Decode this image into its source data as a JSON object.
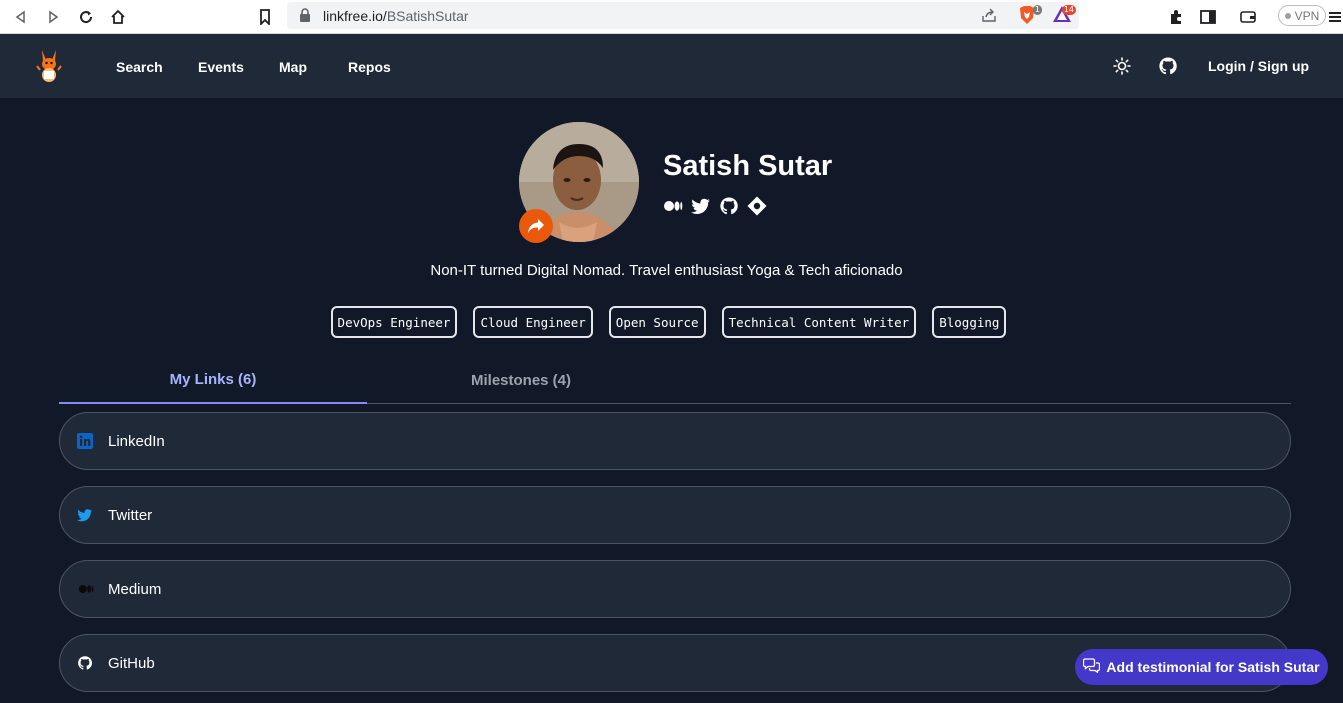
{
  "browser": {
    "url_domain": "linkfree.io/",
    "url_path": "BSatishSutar",
    "brave_badge": "1",
    "ext_badge": "14",
    "vpn_label": "VPN"
  },
  "nav": {
    "links": [
      "Search",
      "Events",
      "Map",
      "Repos"
    ],
    "login_label": "Login / Sign up"
  },
  "profile": {
    "name": "Satish Sutar",
    "bio": "Non-IT turned Digital Nomad. Travel enthusiast Yoga & Tech aficionado",
    "social_icons": [
      "medium-icon",
      "twitter-icon",
      "github-icon",
      "website-icon"
    ],
    "tags": [
      "DevOps Engineer",
      "Cloud Engineer",
      "Open Source",
      "Technical Content Writer",
      "Blogging"
    ]
  },
  "tabs": {
    "links_label": "My Links (6)",
    "milestones_label": "Milestones (4)"
  },
  "links": [
    {
      "label": "LinkedIn",
      "icon": "linkedin-icon",
      "color": "#0a66c2"
    },
    {
      "label": "Twitter",
      "icon": "twitter-icon",
      "color": "#1d9bf0"
    },
    {
      "label": "Medium",
      "icon": "medium-icon",
      "color": "#111111"
    },
    {
      "label": "GitHub",
      "icon": "github-icon",
      "color": "#ffffff"
    }
  ],
  "fab": {
    "label": "Add testimonial for Satish Sutar"
  },
  "colors": {
    "page_bg": "#111827",
    "nav_bg": "#1f2937",
    "accent": "#818cf8",
    "share_button": "#ea580c",
    "fab": "#4338ca"
  }
}
